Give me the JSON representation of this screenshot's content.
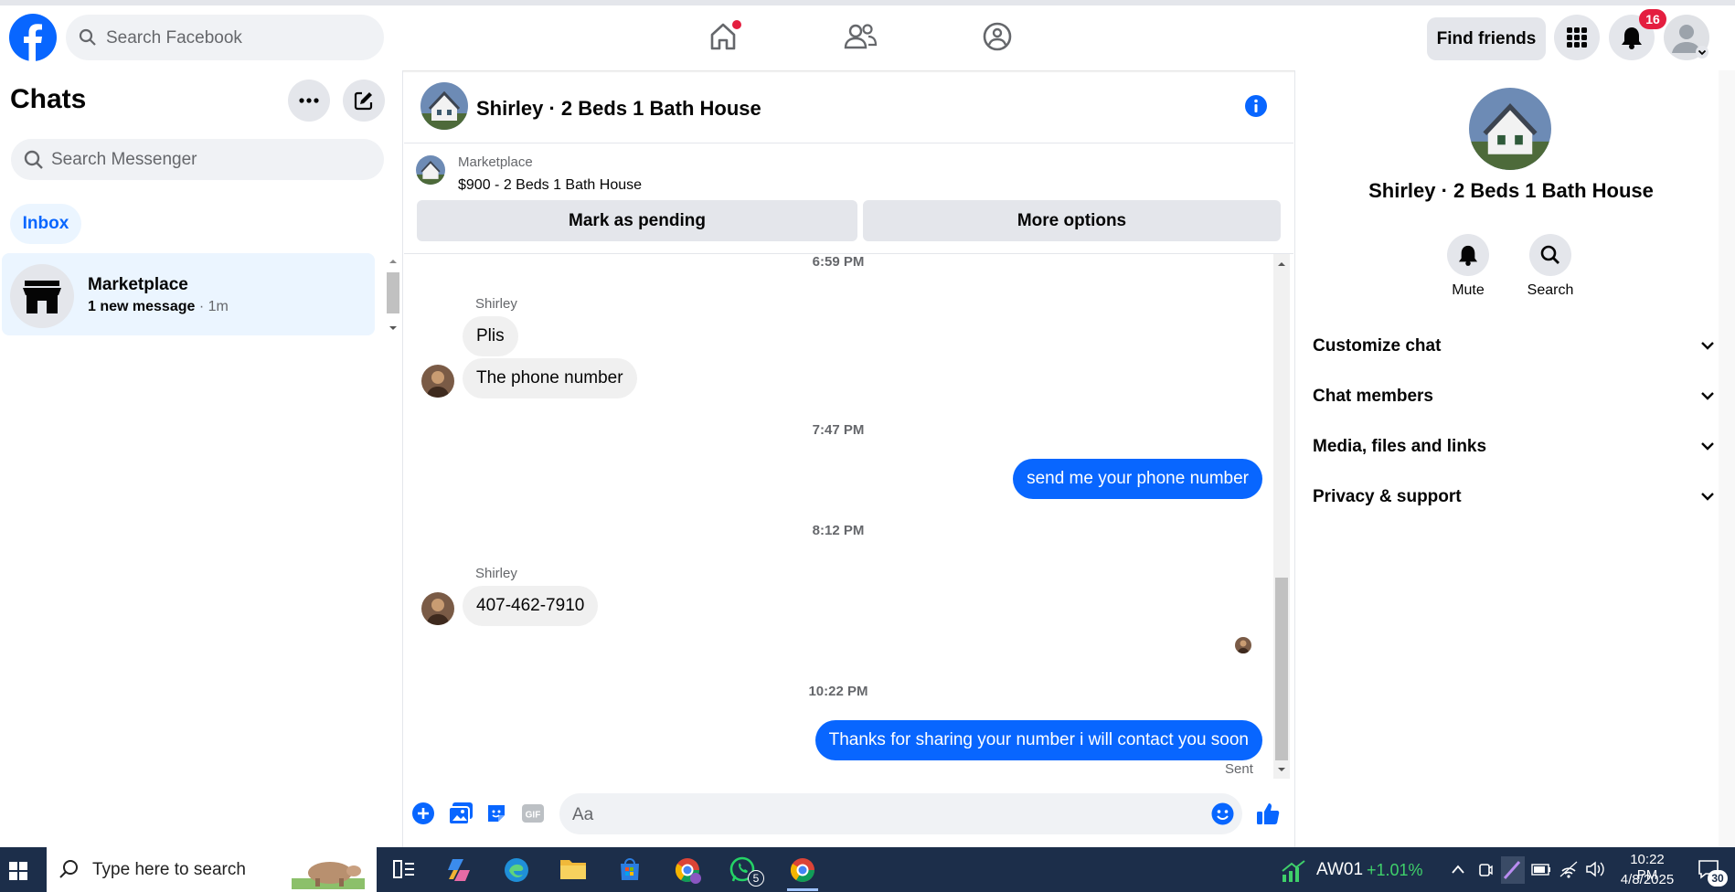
{
  "topbar": {
    "search_placeholder": "Search Facebook",
    "find_friends": "Find friends",
    "notification_count": "16"
  },
  "left": {
    "title": "Chats",
    "search_placeholder": "Search Messenger",
    "inbox_tab": "Inbox",
    "conversations": [
      {
        "name": "Marketplace",
        "preview": "1 new message",
        "time": "· 1m"
      }
    ]
  },
  "chat": {
    "title": "Shirley · 2 Beds 1 Bath House",
    "marketplace_label": "Marketplace",
    "listing": "$900 - 2 Beds 1 Bath House",
    "mark_pending": "Mark as pending",
    "more_options": "More options",
    "messages": {
      "ts1": "6:59 PM",
      "sender1": "Shirley",
      "in1": "Plis",
      "in2": "The phone number",
      "ts2": "7:47 PM",
      "out1": "send me your phone number",
      "ts3": "8:12 PM",
      "sender2": "Shirley",
      "in3": "407-462-7910",
      "ts4": "10:22 PM",
      "out2": "Thanks for sharing your number i will contact you soon",
      "status": "Sent"
    },
    "composer_placeholder": "Aa"
  },
  "right": {
    "title": "Shirley · 2 Beds 1 Bath House",
    "mute": "Mute",
    "search": "Search",
    "sections": [
      "Customize chat",
      "Chat members",
      "Media, files and links",
      "Privacy & support"
    ]
  },
  "taskbar": {
    "search_placeholder": "Type here to search",
    "whatsapp_badge": "5",
    "stock_symbol": "AW01",
    "stock_change": "+1.01%",
    "time": "10:22 PM",
    "date": "4/8/2025",
    "notif_count": "30"
  },
  "colors": {
    "accent": "#0866ff",
    "bubble_in": "#f0f0f0",
    "badge": "#e41e3f",
    "stock_green": "#3fd06a"
  }
}
